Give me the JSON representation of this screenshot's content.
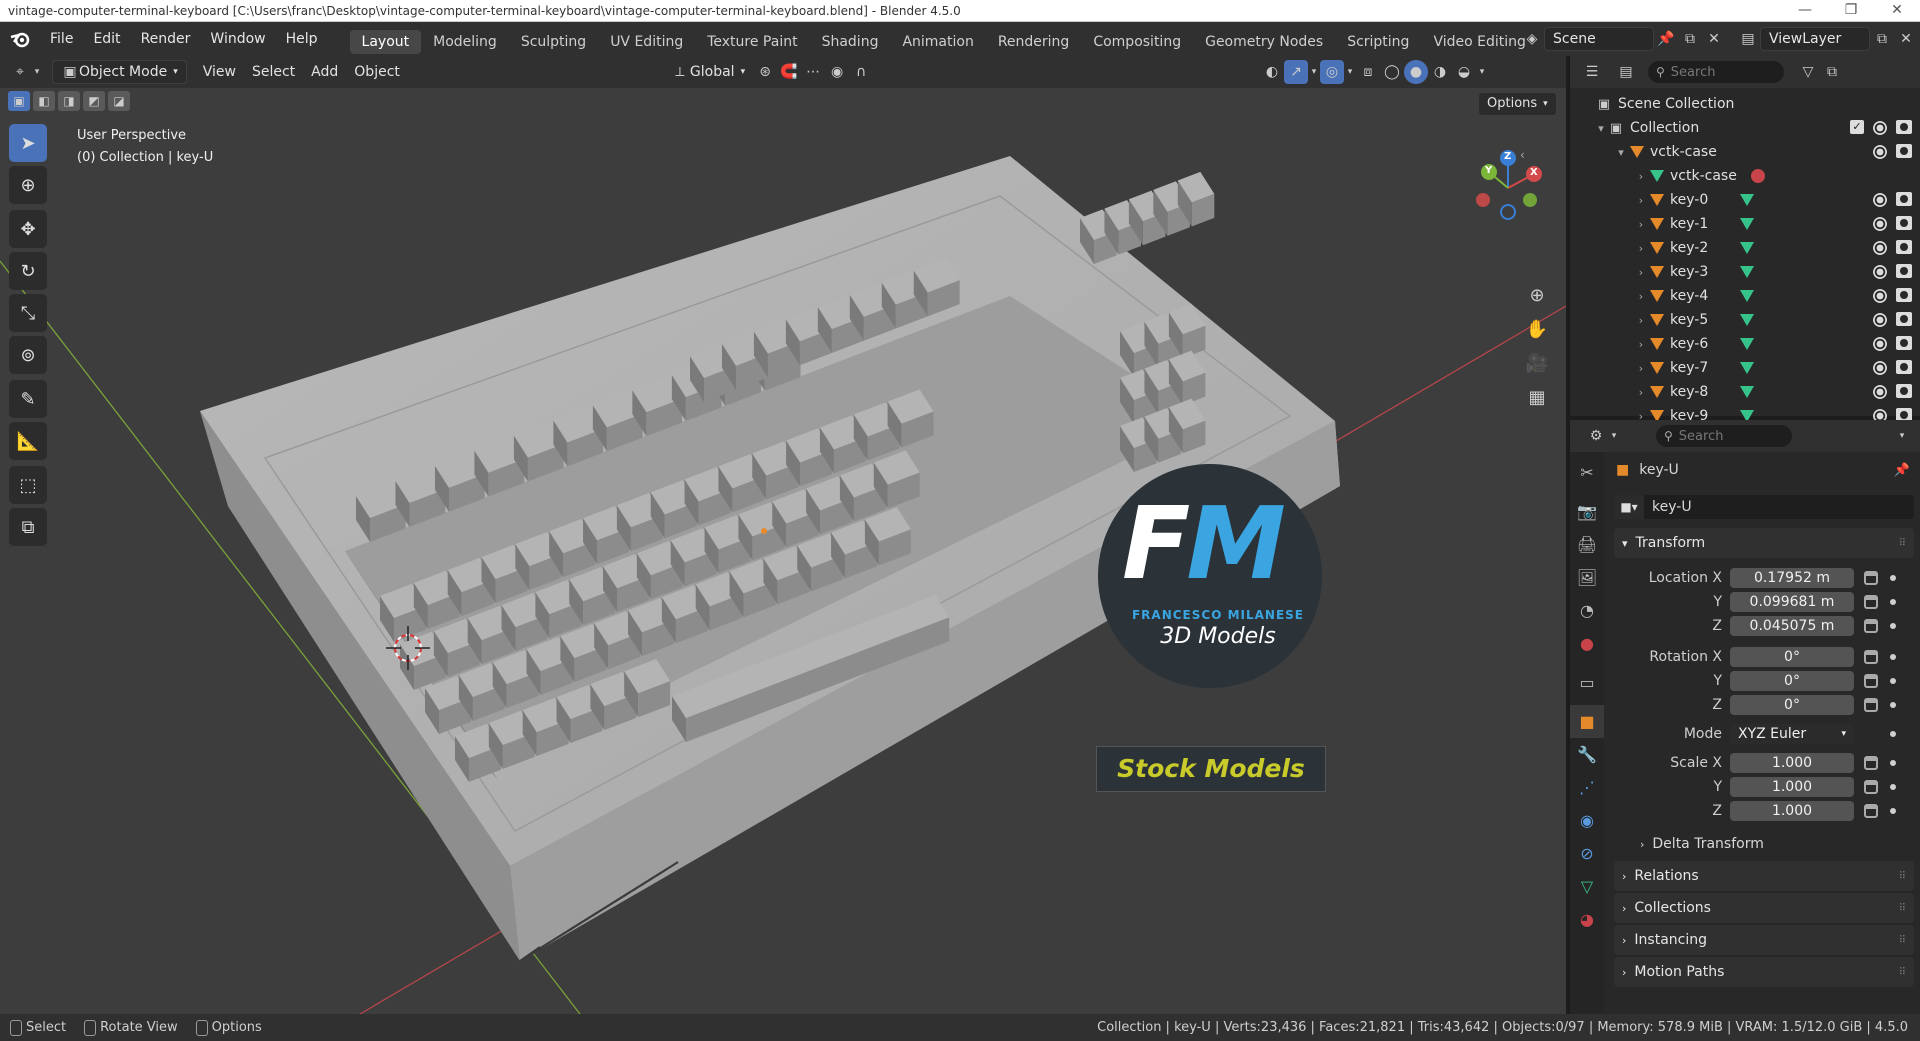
{
  "window": {
    "title": "vintage-computer-terminal-keyboard [C:\\Users\\franc\\Desktop\\vintage-computer-terminal-keyboard\\vintage-computer-terminal-keyboard.blend] - Blender 4.5.0",
    "controls": [
      "—",
      "❐",
      "✕"
    ]
  },
  "menu": [
    "File",
    "Edit",
    "Render",
    "Window",
    "Help"
  ],
  "workspaces": [
    {
      "label": "Layout",
      "active": true
    },
    {
      "label": "Modeling"
    },
    {
      "label": "Sculpting"
    },
    {
      "label": "UV Editing"
    },
    {
      "label": "Texture Paint"
    },
    {
      "label": "Shading"
    },
    {
      "label": "Animation"
    },
    {
      "label": "Rendering"
    },
    {
      "label": "Compositing"
    },
    {
      "label": "Geometry Nodes"
    },
    {
      "label": "Scripting"
    },
    {
      "label": "Video Editing"
    }
  ],
  "scene": {
    "name": "Scene",
    "view_layer": "ViewLayer"
  },
  "viewport": {
    "mode": "Object Mode",
    "menus": [
      "View",
      "Select",
      "Add",
      "Object"
    ],
    "transform_orientation": "Global",
    "options_label": "Options",
    "info_line1": "User Perspective",
    "info_line2": "(0) Collection | key-U",
    "gizmo": {
      "x": "X",
      "y": "Y",
      "z": "Z"
    }
  },
  "watermark": {
    "logo_letters_f": "F",
    "logo_letters_m": "M",
    "brand": "FRANCESCO MILANESE",
    "subtitle": "3D Models",
    "banner": "Stock Models",
    "colors": {
      "accent": "#3aa5e0",
      "banner": "#c9cb2a",
      "circle": "#2b3338"
    }
  },
  "outliner": {
    "search_placeholder": "Search",
    "root": "Scene Collection",
    "collection": "Collection",
    "parent": "vctk-case",
    "mesh_data": "vctk-case",
    "items": [
      "key-0",
      "key-1",
      "key-2",
      "key-3",
      "key-4",
      "key-5",
      "key-6",
      "key-7",
      "key-8",
      "key-9"
    ]
  },
  "properties": {
    "search_placeholder": "Search",
    "object_name": "key-U",
    "datablock_name": "key-U",
    "transform_label": "Transform",
    "location": {
      "label": "Location X",
      "x": "0.17952 m",
      "y": "0.099681 m",
      "z": "0.045075 m"
    },
    "rotation": {
      "label": "Rotation X",
      "x": "0°",
      "y": "0°",
      "z": "0°"
    },
    "mode": {
      "label": "Mode",
      "value": "XYZ Euler"
    },
    "scale": {
      "label": "Scale X",
      "x": "1.000",
      "y": "1.000",
      "z": "1.000"
    },
    "axis_y": "Y",
    "axis_z": "Z",
    "subpanels": [
      "Delta Transform",
      "Relations",
      "Collections",
      "Instancing",
      "Motion Paths"
    ]
  },
  "statusbar": {
    "left": [
      "Select",
      "Rotate View",
      "Options"
    ],
    "right": "Collection | key-U | Verts:23,436 | Faces:21,821 | Tris:43,642 | Objects:0/97 | Memory: 578.9 MiB | VRAM: 1.5/12.0 GiB | 4.5.0"
  }
}
